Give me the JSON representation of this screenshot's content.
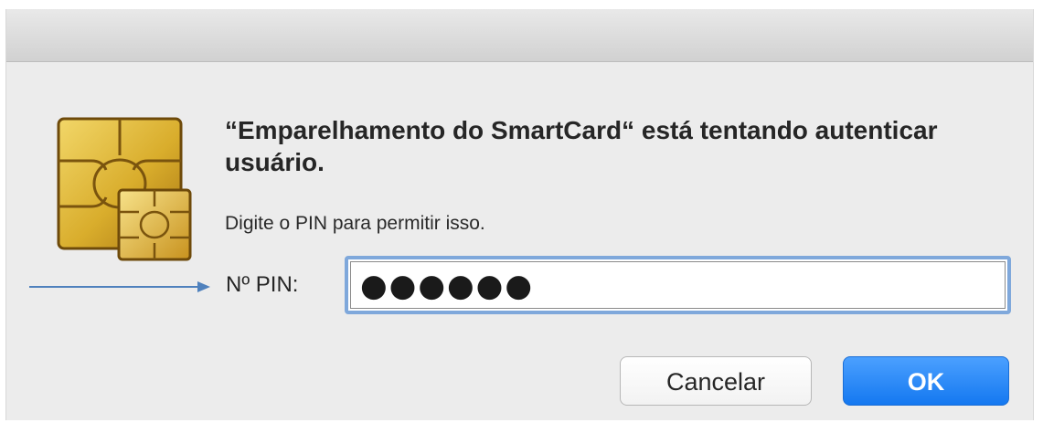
{
  "dialog": {
    "title_bar": "",
    "icon": "smartcard-chip-icon",
    "headline": "“Emparelhamento do SmartCard“ está tentando autenticar usuário.",
    "subtext": "Digite o PIN para permitir isso."
  },
  "pin": {
    "label": "Nº PIN:",
    "masked_value": "●●●●●●"
  },
  "buttons": {
    "cancel_label": "Cancelar",
    "ok_label": "OK"
  },
  "colors": {
    "accent": "#1478f0",
    "focus_ring": "#7fa8db",
    "dialog_background": "#ececec",
    "annotation_arrow": "#4f81bd"
  }
}
